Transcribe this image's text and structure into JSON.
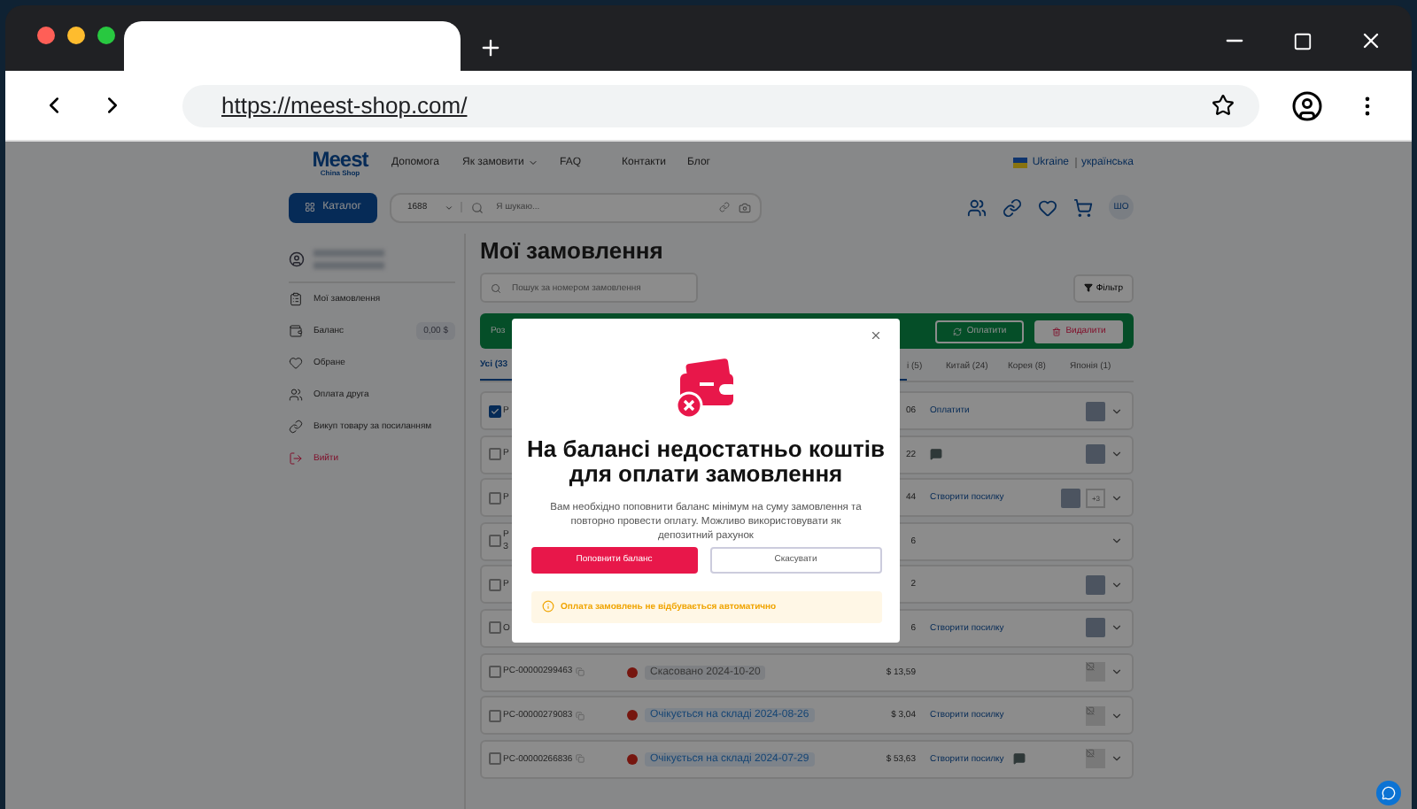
{
  "browser": {
    "url": "https://meest-shop.com/"
  },
  "header": {
    "logo": "Meest",
    "logo_sub": "China Shop",
    "nav": [
      {
        "label": "Допомога",
        "dropdown": false
      },
      {
        "label": "Як замовити",
        "dropdown": true
      },
      {
        "label": "FAQ",
        "dropdown": false
      },
      {
        "label": "Контакти",
        "dropdown": false
      },
      {
        "label": "Блог",
        "dropdown": false
      }
    ],
    "country": "Ukraine",
    "language": "українська",
    "catalog_button": "Каталог",
    "source": "1688",
    "search_placeholder": "Я шукаю...",
    "avatar": "ШО"
  },
  "sidebar": {
    "items": [
      {
        "kind": "orders",
        "label": "Мої замовлення"
      },
      {
        "kind": "balance",
        "label": "Баланс",
        "badge": "0,00 $"
      },
      {
        "kind": "favorites",
        "label": "Обране"
      },
      {
        "kind": "friend",
        "label": "Оплата друга"
      },
      {
        "kind": "link",
        "label": "Викуп товару за посиланням"
      },
      {
        "kind": "logout",
        "label": "Вийти"
      }
    ]
  },
  "main": {
    "title": "Мої замовлення",
    "search_placeholder": "Пошук за номером замовлення",
    "filter_button": "Фільтр",
    "selection_bar": {
      "text": "Роз",
      "pay_button": "Оплатити",
      "delete_button": "Видалити"
    },
    "tabs": [
      {
        "label": "Усі (33",
        "selected": true
      },
      {
        "label": "і (5)",
        "selected": false
      },
      {
        "label": "Китай (24)",
        "selected": false
      },
      {
        "label": "Корея (8)",
        "selected": false
      },
      {
        "label": "Японія (1)",
        "selected": false
      }
    ],
    "orders": [
      {
        "kind": "photo",
        "checked": true,
        "id": "Р",
        "price": "06",
        "action": "Оплатити",
        "chat": false
      },
      {
        "kind": "photo",
        "checked": false,
        "id": "Р",
        "price": "22",
        "chat": true
      },
      {
        "kind": "photo",
        "checked": false,
        "id": "Р",
        "price": "44",
        "action": "Створити посилку",
        "chat": false,
        "more": "+3"
      },
      {
        "kind": "plain",
        "checked": false,
        "id": "Р",
        "sub": "З",
        "price": "6",
        "chat": false
      },
      {
        "kind": "photo",
        "checked": false,
        "id": "Р",
        "price": "2",
        "chat": false
      },
      {
        "kind": "photo",
        "checked": false,
        "id": "О",
        "price": "6",
        "action": "Створити посилку",
        "chat": false
      },
      {
        "kind": "broken",
        "checked": false,
        "id": "PC-00000299463",
        "cancelled": true,
        "status": "Скасовано 2024-10-20",
        "price": "$ 13,59",
        "chat": false
      },
      {
        "kind": "broken",
        "checked": false,
        "id": "PC-00000279083",
        "cancelled": false,
        "status": "Очікується на складі 2024-08-26",
        "price": "$ 3,04",
        "action": "Створити посилку",
        "chat": false
      },
      {
        "kind": "broken",
        "checked": false,
        "id": "PC-00000266836",
        "cancelled": false,
        "status": "Очікується на складі 2024-07-29",
        "price": "$ 53,63",
        "action": "Створити посилку",
        "chat": true
      }
    ]
  },
  "modal": {
    "title": "На балансі недостатньо коштів для оплати замовлення",
    "text": "Вам необхідно поповнити баланс мінімум на суму замовлення та повторно провести оплату. Можливо використовувати як депозитний рахунок",
    "primary_button": "Поповнити баланс",
    "secondary_button": "Скасувати",
    "notice": "Оплата замовлень не відбувається автоматично"
  }
}
